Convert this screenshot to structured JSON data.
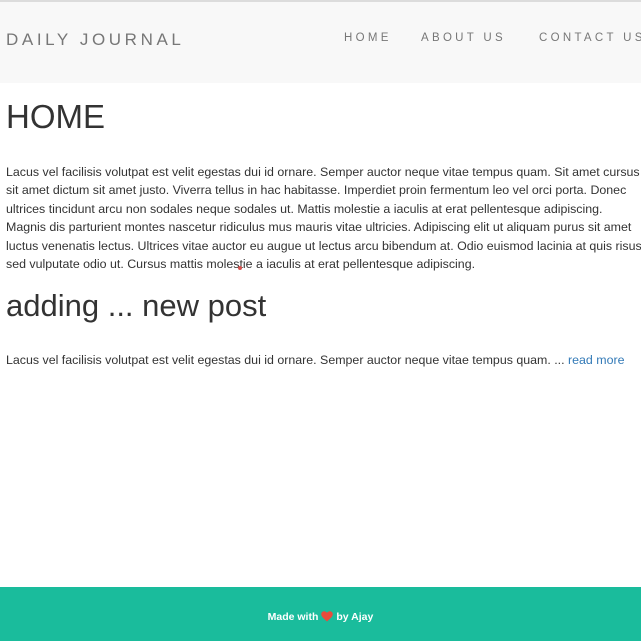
{
  "navbar": {
    "brand": "DAILY JOURNAL",
    "links": [
      "HOME",
      "ABOUT US",
      "CONTACT US"
    ]
  },
  "main": {
    "title": "HOME",
    "home_lines": [
      "Lacus vel facilisis volutpat est velit egestas dui id ornare. Semper auctor neque vitae tempus quam. Sit amet cursus",
      "sit amet dictum sit amet justo. Viverra tellus in hac habitasse. Imperdiet proin fermentum leo vel orci porta. Donec",
      "ultrices tincidunt arcu non sodales neque sodales ut. Mattis molestie a iaculis at erat pellentesque adipiscing.",
      "Magnis dis parturient montes nascetur ridiculus mus mauris vitae ultricies. Adipiscing elit ut aliquam purus sit amet",
      "luctus venenatis lectus. Ultrices vitae auctor eu augue ut lectus arcu bibendum at. Odio euismod lacinia at quis risus",
      "sed vulputate odio ut. Cursus mattis molestie a iaculis at erat pellentesque adipiscing."
    ]
  },
  "post": {
    "title": "adding ... new post",
    "excerpt": "Lacus vel facilisis volutpat est velit egestas dui id ornare. Semper auctor neque vitae tempus quam. ...",
    "read_more": "read more"
  },
  "footer": {
    "made_with": "Made with",
    "by": "by Ajay",
    "heart_icon": "heart-icon",
    "heart_color": "#e74c3c",
    "background_color": "#1abc9c"
  },
  "colors": {
    "link": "#337ab7",
    "navbar_bg": "#f8f8f8"
  }
}
